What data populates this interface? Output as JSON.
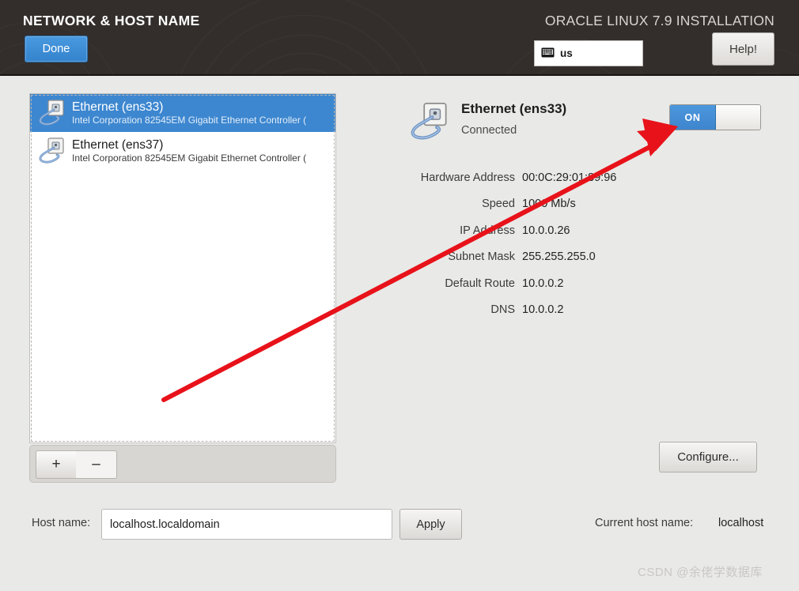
{
  "header": {
    "page_title": "NETWORK & HOST NAME",
    "install_title": "ORACLE LINUX 7.9 INSTALLATION",
    "done_label": "Done",
    "help_label": "Help!",
    "keyboard_icon": "keyboard-icon",
    "keyboard_layout": "us"
  },
  "device_list": {
    "items": [
      {
        "icon": "ethernet-jack-icon",
        "name": "Ethernet (ens33)",
        "description": "Intel Corporation 82545EM Gigabit Ethernet Controller (",
        "selected": true
      },
      {
        "icon": "ethernet-jack-icon",
        "name": "Ethernet (ens37)",
        "description": "Intel Corporation 82545EM Gigabit Ethernet Controller (",
        "selected": false
      }
    ],
    "add_label": "+",
    "remove_label": "–"
  },
  "detail": {
    "icon": "ethernet-jack-icon",
    "name": "Ethernet (ens33)",
    "status": "Connected",
    "toggle_on_label": "ON",
    "toggle_state": "on",
    "fields": [
      {
        "label": "Hardware Address",
        "value": "00:0C:29:01:89:96"
      },
      {
        "label": "Speed",
        "value": "1000 Mb/s"
      },
      {
        "label": "IP Address",
        "value": "10.0.0.26"
      },
      {
        "label": "Subnet Mask",
        "value": "255.255.255.0"
      },
      {
        "label": "Default Route",
        "value": "10.0.0.2"
      },
      {
        "label": "DNS",
        "value": "10.0.0.2"
      }
    ],
    "configure_label": "Configure..."
  },
  "bottom": {
    "hostname_label": "Host name:",
    "hostname_value": "localhost.localdomain",
    "hostname_placeholder": "localhost.localdomain",
    "apply_label": "Apply",
    "current_hostname_label": "Current host name:",
    "current_hostname_value": "localhost"
  },
  "watermark": "CSDN @余佬学数据库",
  "colors": {
    "header_bg": "#332e2c",
    "accent_blue": "#3d87d0",
    "panel_bg": "#e9e9e7",
    "annotation_red": "#e8121a"
  }
}
